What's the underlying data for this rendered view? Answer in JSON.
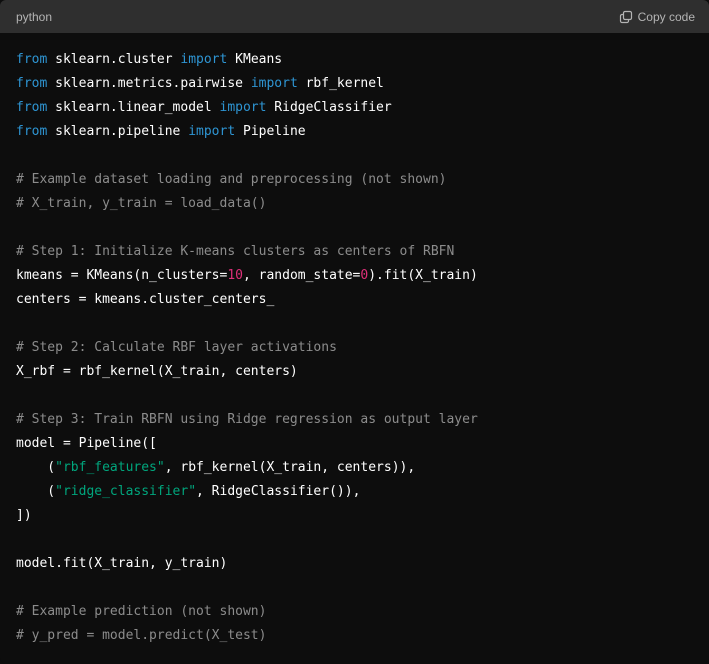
{
  "header": {
    "language": "python",
    "copy_label": "Copy code",
    "copy_icon": "copy-icon"
  },
  "colors": {
    "keyword": "#2e95d3",
    "comment": "#8c8c8c",
    "number": "#df3079",
    "string": "#00a67d",
    "text": "#ffffff"
  },
  "code": {
    "lines": [
      [
        {
          "t": "kw",
          "v": "from"
        },
        {
          "t": "p",
          "v": " sklearn.cluster "
        },
        {
          "t": "kw",
          "v": "import"
        },
        {
          "t": "p",
          "v": " KMeans"
        }
      ],
      [
        {
          "t": "kw",
          "v": "from"
        },
        {
          "t": "p",
          "v": " sklearn.metrics.pairwise "
        },
        {
          "t": "kw",
          "v": "import"
        },
        {
          "t": "p",
          "v": " rbf_kernel"
        }
      ],
      [
        {
          "t": "kw",
          "v": "from"
        },
        {
          "t": "p",
          "v": " sklearn.linear_model "
        },
        {
          "t": "kw",
          "v": "import"
        },
        {
          "t": "p",
          "v": " RidgeClassifier"
        }
      ],
      [
        {
          "t": "kw",
          "v": "from"
        },
        {
          "t": "p",
          "v": " sklearn.pipeline "
        },
        {
          "t": "kw",
          "v": "import"
        },
        {
          "t": "p",
          "v": " Pipeline"
        }
      ],
      [],
      [
        {
          "t": "cm",
          "v": "# Example dataset loading and preprocessing (not shown)"
        }
      ],
      [
        {
          "t": "cm",
          "v": "# X_train, y_train = load_data()"
        }
      ],
      [],
      [
        {
          "t": "cm",
          "v": "# Step 1: Initialize K-means clusters as centers of RBFN"
        }
      ],
      [
        {
          "t": "p",
          "v": "kmeans = KMeans(n_clusters="
        },
        {
          "t": "num",
          "v": "10"
        },
        {
          "t": "p",
          "v": ", random_state="
        },
        {
          "t": "num",
          "v": "0"
        },
        {
          "t": "p",
          "v": ").fit(X_train)"
        }
      ],
      [
        {
          "t": "p",
          "v": "centers = kmeans.cluster_centers_"
        }
      ],
      [],
      [
        {
          "t": "cm",
          "v": "# Step 2: Calculate RBF layer activations"
        }
      ],
      [
        {
          "t": "p",
          "v": "X_rbf = rbf_kernel(X_train, centers)"
        }
      ],
      [],
      [
        {
          "t": "cm",
          "v": "# Step 3: Train RBFN using Ridge regression as output layer"
        }
      ],
      [
        {
          "t": "p",
          "v": "model = Pipeline(["
        }
      ],
      [
        {
          "t": "p",
          "v": "    ("
        },
        {
          "t": "str",
          "v": "\"rbf_features\""
        },
        {
          "t": "p",
          "v": ", rbf_kernel(X_train, centers)),"
        }
      ],
      [
        {
          "t": "p",
          "v": "    ("
        },
        {
          "t": "str",
          "v": "\"ridge_classifier\""
        },
        {
          "t": "p",
          "v": ", RidgeClassifier()),"
        }
      ],
      [
        {
          "t": "p",
          "v": "])"
        }
      ],
      [],
      [
        {
          "t": "p",
          "v": "model.fit(X_train, y_train)"
        }
      ],
      [],
      [
        {
          "t": "cm",
          "v": "# Example prediction (not shown)"
        }
      ],
      [
        {
          "t": "cm",
          "v": "# y_pred = model.predict(X_test)"
        }
      ]
    ]
  }
}
